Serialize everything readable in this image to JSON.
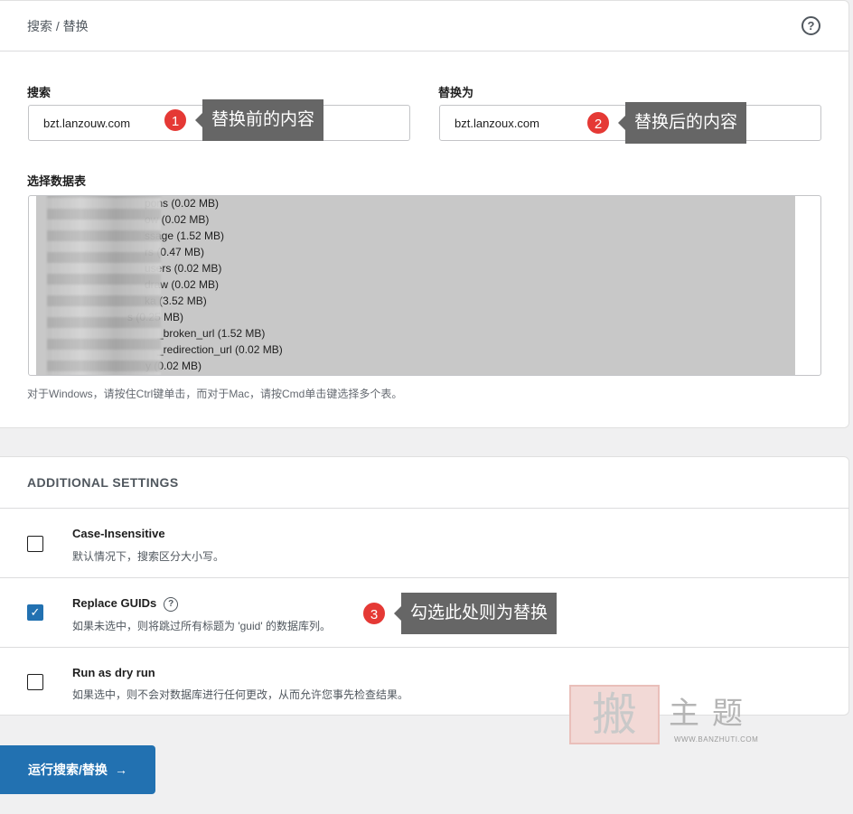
{
  "header": {
    "breadcrumb": "搜索 / 替换",
    "help_icon": "?"
  },
  "search": {
    "label": "搜索",
    "value": "bzt.lanzouw.com"
  },
  "replace": {
    "label": "替换为",
    "value": "bzt.lanzoux.com"
  },
  "tables": {
    "label": "选择数据表",
    "rows": [
      "pons (0.02 MB)",
      "ow (0.02 MB)",
      "ssage (1.52 MB)",
      "rs (0.47 MB)",
      "users (0.02 MB)",
      "draw (0.02 MB)",
      "ka (3.52 MB)",
      "s (0.25 MB)",
      "_broken_url (1.52 MB)",
      "_redirection_url (0.02 MB)",
      "y (0.02 MB)"
    ],
    "scroll_up": "▲",
    "scroll_down": "▼",
    "hint": "对于Windows，请按住Ctrl键单击，而对于Mac，请按Cmd单击键选择多个表。"
  },
  "additional": {
    "title": "ADDITIONAL SETTINGS",
    "case": {
      "title": "Case-Insensitive",
      "desc": "默认情况下，搜索区分大小写。",
      "checked": false
    },
    "guids": {
      "title": "Replace GUIDs",
      "desc": "如果未选中，则将跳过所有标题为 'guid' 的数据库列。",
      "checked": true,
      "help": "?",
      "check_mark": "✓"
    },
    "dryrun": {
      "title": "Run as dry run",
      "desc": "如果选中，则不会对数据库进行任何更改，从而允许您事先检查结果。",
      "checked": false
    }
  },
  "run_button": {
    "label": "运行搜索/替换",
    "arrow": "→"
  },
  "callouts": [
    {
      "num": "1",
      "text": "替换前的内容"
    },
    {
      "num": "2",
      "text": "替换后的内容"
    },
    {
      "num": "3",
      "text": "勾选此处则为替换"
    }
  ],
  "watermark": {
    "stamp": "搬",
    "text": "主题",
    "url": "WWW.BANZHUTI.COM"
  },
  "colors": {
    "primary": "#2271b1",
    "callout_num": "#e53935",
    "callout_tip": "#666666",
    "selection": "#c8c8c8"
  }
}
